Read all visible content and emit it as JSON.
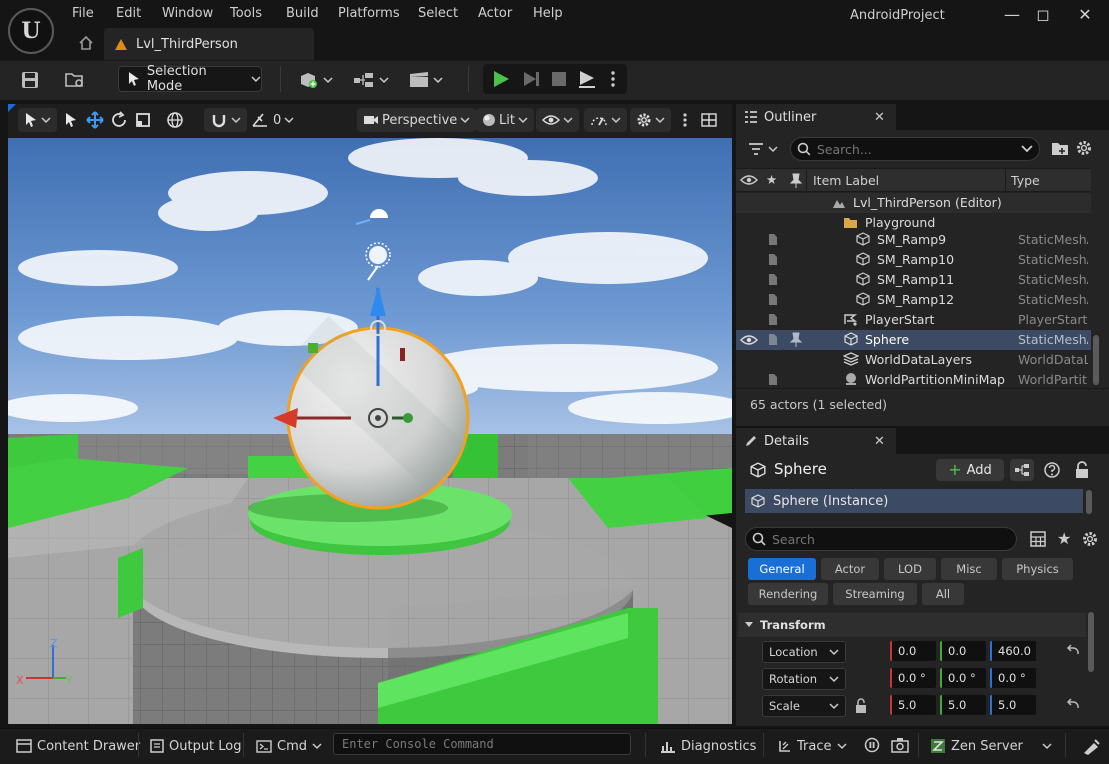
{
  "window": {
    "title": "AndroidProject",
    "menu": [
      "File",
      "Edit",
      "Window",
      "Tools",
      "Build",
      "Platforms",
      "Select",
      "Actor",
      "Help"
    ],
    "level_tab": "Lvl_ThirdPerson"
  },
  "toolbar": {
    "selection_mode": "Selection Mode"
  },
  "viewport": {
    "snap_value": "0",
    "perspective_label": "Perspective",
    "lit_label": "Lit",
    "axis_labels": {
      "z": "Z",
      "x": "X",
      "y": "Y"
    }
  },
  "outliner": {
    "tab_label": "Outliner",
    "search_placeholder": "Search...",
    "columns": {
      "label": "Item Label",
      "type": "Type"
    },
    "items": [
      {
        "label": "Lvl_ThirdPerson (Editor)",
        "type": "",
        "icon": "level-icon"
      },
      {
        "label": "Playground",
        "type": "",
        "icon": "folder-icon"
      },
      {
        "label": "SM_Ramp9",
        "type": "StaticMeshA",
        "icon": "mesh-icon"
      },
      {
        "label": "SM_Ramp10",
        "type": "StaticMeshA",
        "icon": "mesh-icon"
      },
      {
        "label": "SM_Ramp11",
        "type": "StaticMeshA",
        "icon": "mesh-icon"
      },
      {
        "label": "SM_Ramp12",
        "type": "StaticMeshA",
        "icon": "mesh-icon"
      },
      {
        "label": "PlayerStart",
        "type": "PlayerStart",
        "icon": "player-start-icon"
      },
      {
        "label": "Sphere",
        "type": "StaticMeshA",
        "icon": "mesh-icon",
        "selected": true
      },
      {
        "label": "WorldDataLayers",
        "type": "WorldDataLa",
        "icon": "layers-icon"
      },
      {
        "label": "WorldPartitionMiniMap",
        "type": "WorldPartitic",
        "icon": "minimap-icon"
      }
    ],
    "actor_count": "65 actors (1 selected)"
  },
  "details": {
    "tab_label": "Details",
    "selected_name": "Sphere",
    "add_label": "Add",
    "instance_label": "Sphere (Instance)",
    "search_placeholder": "Search",
    "categories": [
      "General",
      "Actor",
      "LOD",
      "Misc",
      "Physics",
      "Rendering",
      "Streaming",
      "All"
    ],
    "active_category": "General",
    "transform_label": "Transform",
    "transform": [
      {
        "name": "Location",
        "x": "0.0",
        "y": "0.0",
        "z": "460.0"
      },
      {
        "name": "Rotation",
        "x": "0.0 °",
        "y": "0.0 °",
        "z": "0.0 °"
      },
      {
        "name": "Scale",
        "x": "5.0",
        "y": "5.0",
        "z": "5.0"
      }
    ]
  },
  "statusbar": {
    "content_drawer": "Content Drawer",
    "output_log": "Output Log",
    "cmd": "Cmd",
    "console_placeholder": "Enter Console Command",
    "diagnostics": "Diagnostics",
    "trace": "Trace",
    "zen_server": "Zen Server"
  },
  "colors": {
    "selection_outline": "#f2a21c",
    "accent_blue": "#1a6fd6",
    "play_green": "#4cc24c",
    "axis_x": "#c83535",
    "axis_y": "#4aa53a",
    "axis_z": "#2f6fd6"
  }
}
